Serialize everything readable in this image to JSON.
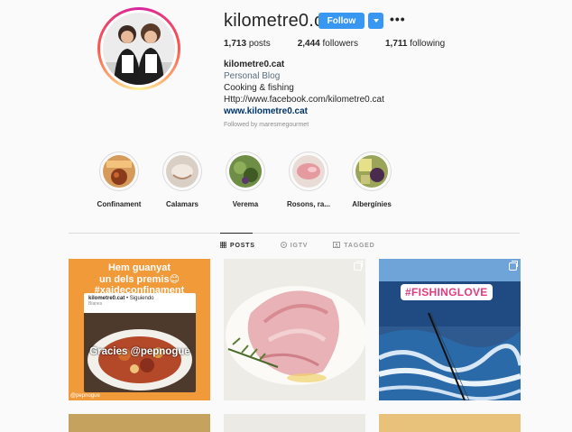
{
  "profile": {
    "username": "kilometre0.cat",
    "follow_label": "Follow",
    "more_label": "•••",
    "stats": {
      "posts_count": "1,713",
      "posts_label": "posts",
      "followers_count": "2,444",
      "followers_label": "followers",
      "following_count": "1,711",
      "following_label": "following"
    },
    "bio": {
      "name": "kilometre0.cat",
      "category": "Personal Blog",
      "line1": "Cooking & fishing",
      "line2": "Http://www.facebook.com/kilometre0.cat",
      "link": "www.kilometre0.cat"
    },
    "followed_by": "Followed by maresmegourmet"
  },
  "highlights": [
    {
      "label": "Confinament",
      "color": "#b86a2a"
    },
    {
      "label": "Calamars",
      "color": "#c9b9a6"
    },
    {
      "label": "Verema",
      "color": "#5a7a38"
    },
    {
      "label": "Rosons, ra...",
      "color": "#d98a8f"
    },
    {
      "label": "Albergínies",
      "color": "#7d8a35"
    }
  ],
  "tabs": [
    {
      "label": "POSTS",
      "icon": "grid-icon",
      "active": true
    },
    {
      "label": "IGTV",
      "icon": "igtv-icon",
      "active": false
    },
    {
      "label": "TAGGED",
      "icon": "tag-icon",
      "active": false
    }
  ],
  "posts": {
    "p1": {
      "title1": "Hem guanyat",
      "title2": "un dels premis😊",
      "title3": "#xaideconfinament",
      "card_user": "kilometre0.cat",
      "card_follow": "• Siguiendo",
      "card_loc": "Blanes",
      "overlay": "Gracies @pepnogue",
      "footer": "@pepnogue"
    },
    "p3": {
      "tag": "#FISHINGLOVE"
    }
  },
  "colors": {
    "accent": "#3897f0",
    "link": "#003569",
    "category": "#5c6f80",
    "muted": "#8e8e8e"
  }
}
